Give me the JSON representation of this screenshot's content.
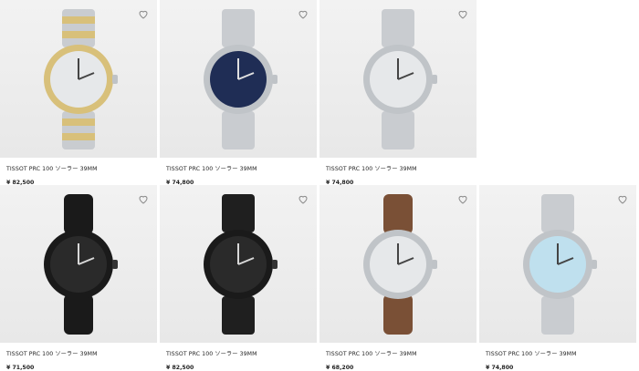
{
  "products": [
    {
      "name": "TISSOT PRC 100 ソーラー 39MM",
      "price": "¥ 82,500"
    },
    {
      "name": "TISSOT PRC 100 ソーラー 39MM",
      "price": "¥ 74,800"
    },
    {
      "name": "TISSOT PRC 100 ソーラー 39MM",
      "price": "¥ 74,800"
    },
    {
      "name": "TISSOT PRC 100 ソーラー 39MM",
      "price": "¥ 71,500"
    },
    {
      "name": "TISSOT PRC 100 ソーラー 39MM",
      "price": "¥ 82,500"
    },
    {
      "name": "TISSOT PRC 100 ソーラー 39MM",
      "price": "¥ 68,200"
    },
    {
      "name": "TISSOT PRC 100 ソーラー 39MM",
      "price": "¥ 74,800"
    }
  ],
  "icons": {
    "favorite": "heart-outline-icon"
  },
  "colors": {
    "steel": "#c9ccd0",
    "gold": "#d8c07a",
    "navy_dial": "#1f2d55",
    "black": "#1a1a1a",
    "brown_strap": "#7a5036",
    "ice_blue_dial": "#bfe0ee"
  }
}
